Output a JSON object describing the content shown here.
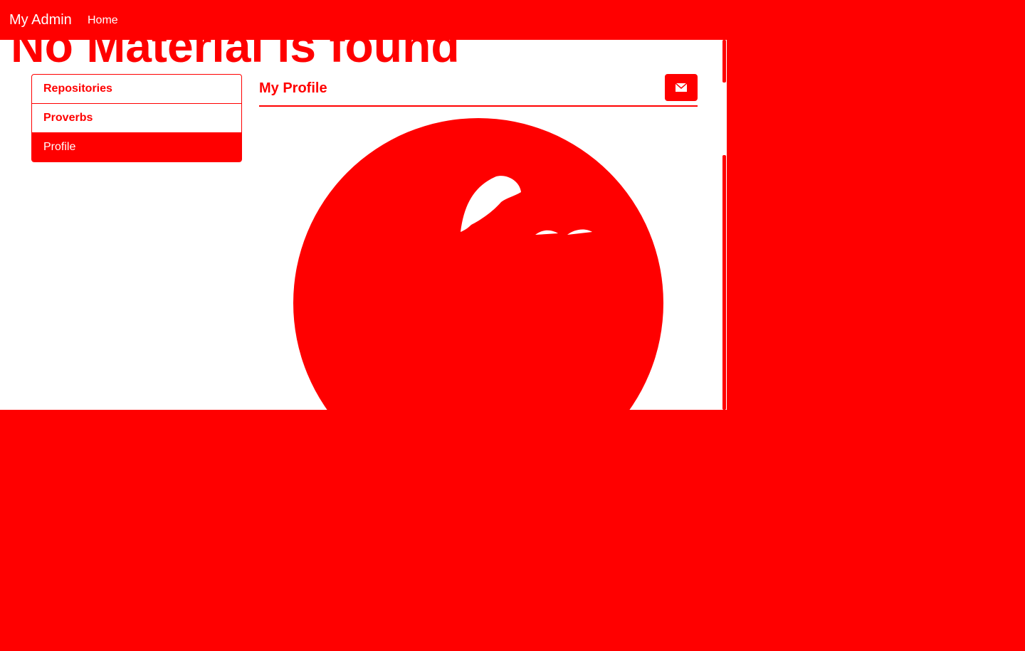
{
  "navbar": {
    "brand": "My Admin",
    "links": [
      {
        "label": "Home"
      }
    ]
  },
  "main": {
    "heading": "No Material is found",
    "panel_title": "My Profile",
    "mail_icon": "envelope-icon"
  },
  "sidebar": {
    "items": [
      {
        "label": "Repositories",
        "active": false
      },
      {
        "label": "Proverbs",
        "active": false
      },
      {
        "label": "Profile",
        "active": true
      }
    ]
  },
  "colors": {
    "accent": "#ff0000",
    "background": "#ffffff",
    "text_on_accent": "#ffffff"
  }
}
